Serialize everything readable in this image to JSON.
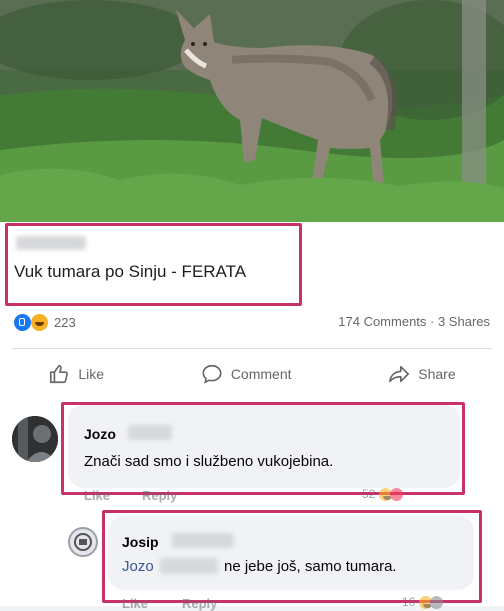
{
  "post": {
    "title": "Vuk tumara po Sinju - FERATA",
    "reaction_count": "223",
    "stats": "174 Comments · 3 Shares"
  },
  "actions": {
    "like": "Like",
    "comment": "Comment",
    "share": "Share"
  },
  "comments": [
    {
      "author": "Jozo",
      "text": "Znači sad smo i službeno vukojebina.",
      "like": "Like",
      "reply": "Reply",
      "reactions": "52"
    },
    {
      "author": "Josip",
      "mention": "Jozo",
      "text": "ne jebe još, samo tumara.",
      "like": "Like",
      "reply": "Reply",
      "reactions": "16"
    }
  ],
  "colors": {
    "highlight": "#c8326a",
    "brand": "#1877f2"
  }
}
